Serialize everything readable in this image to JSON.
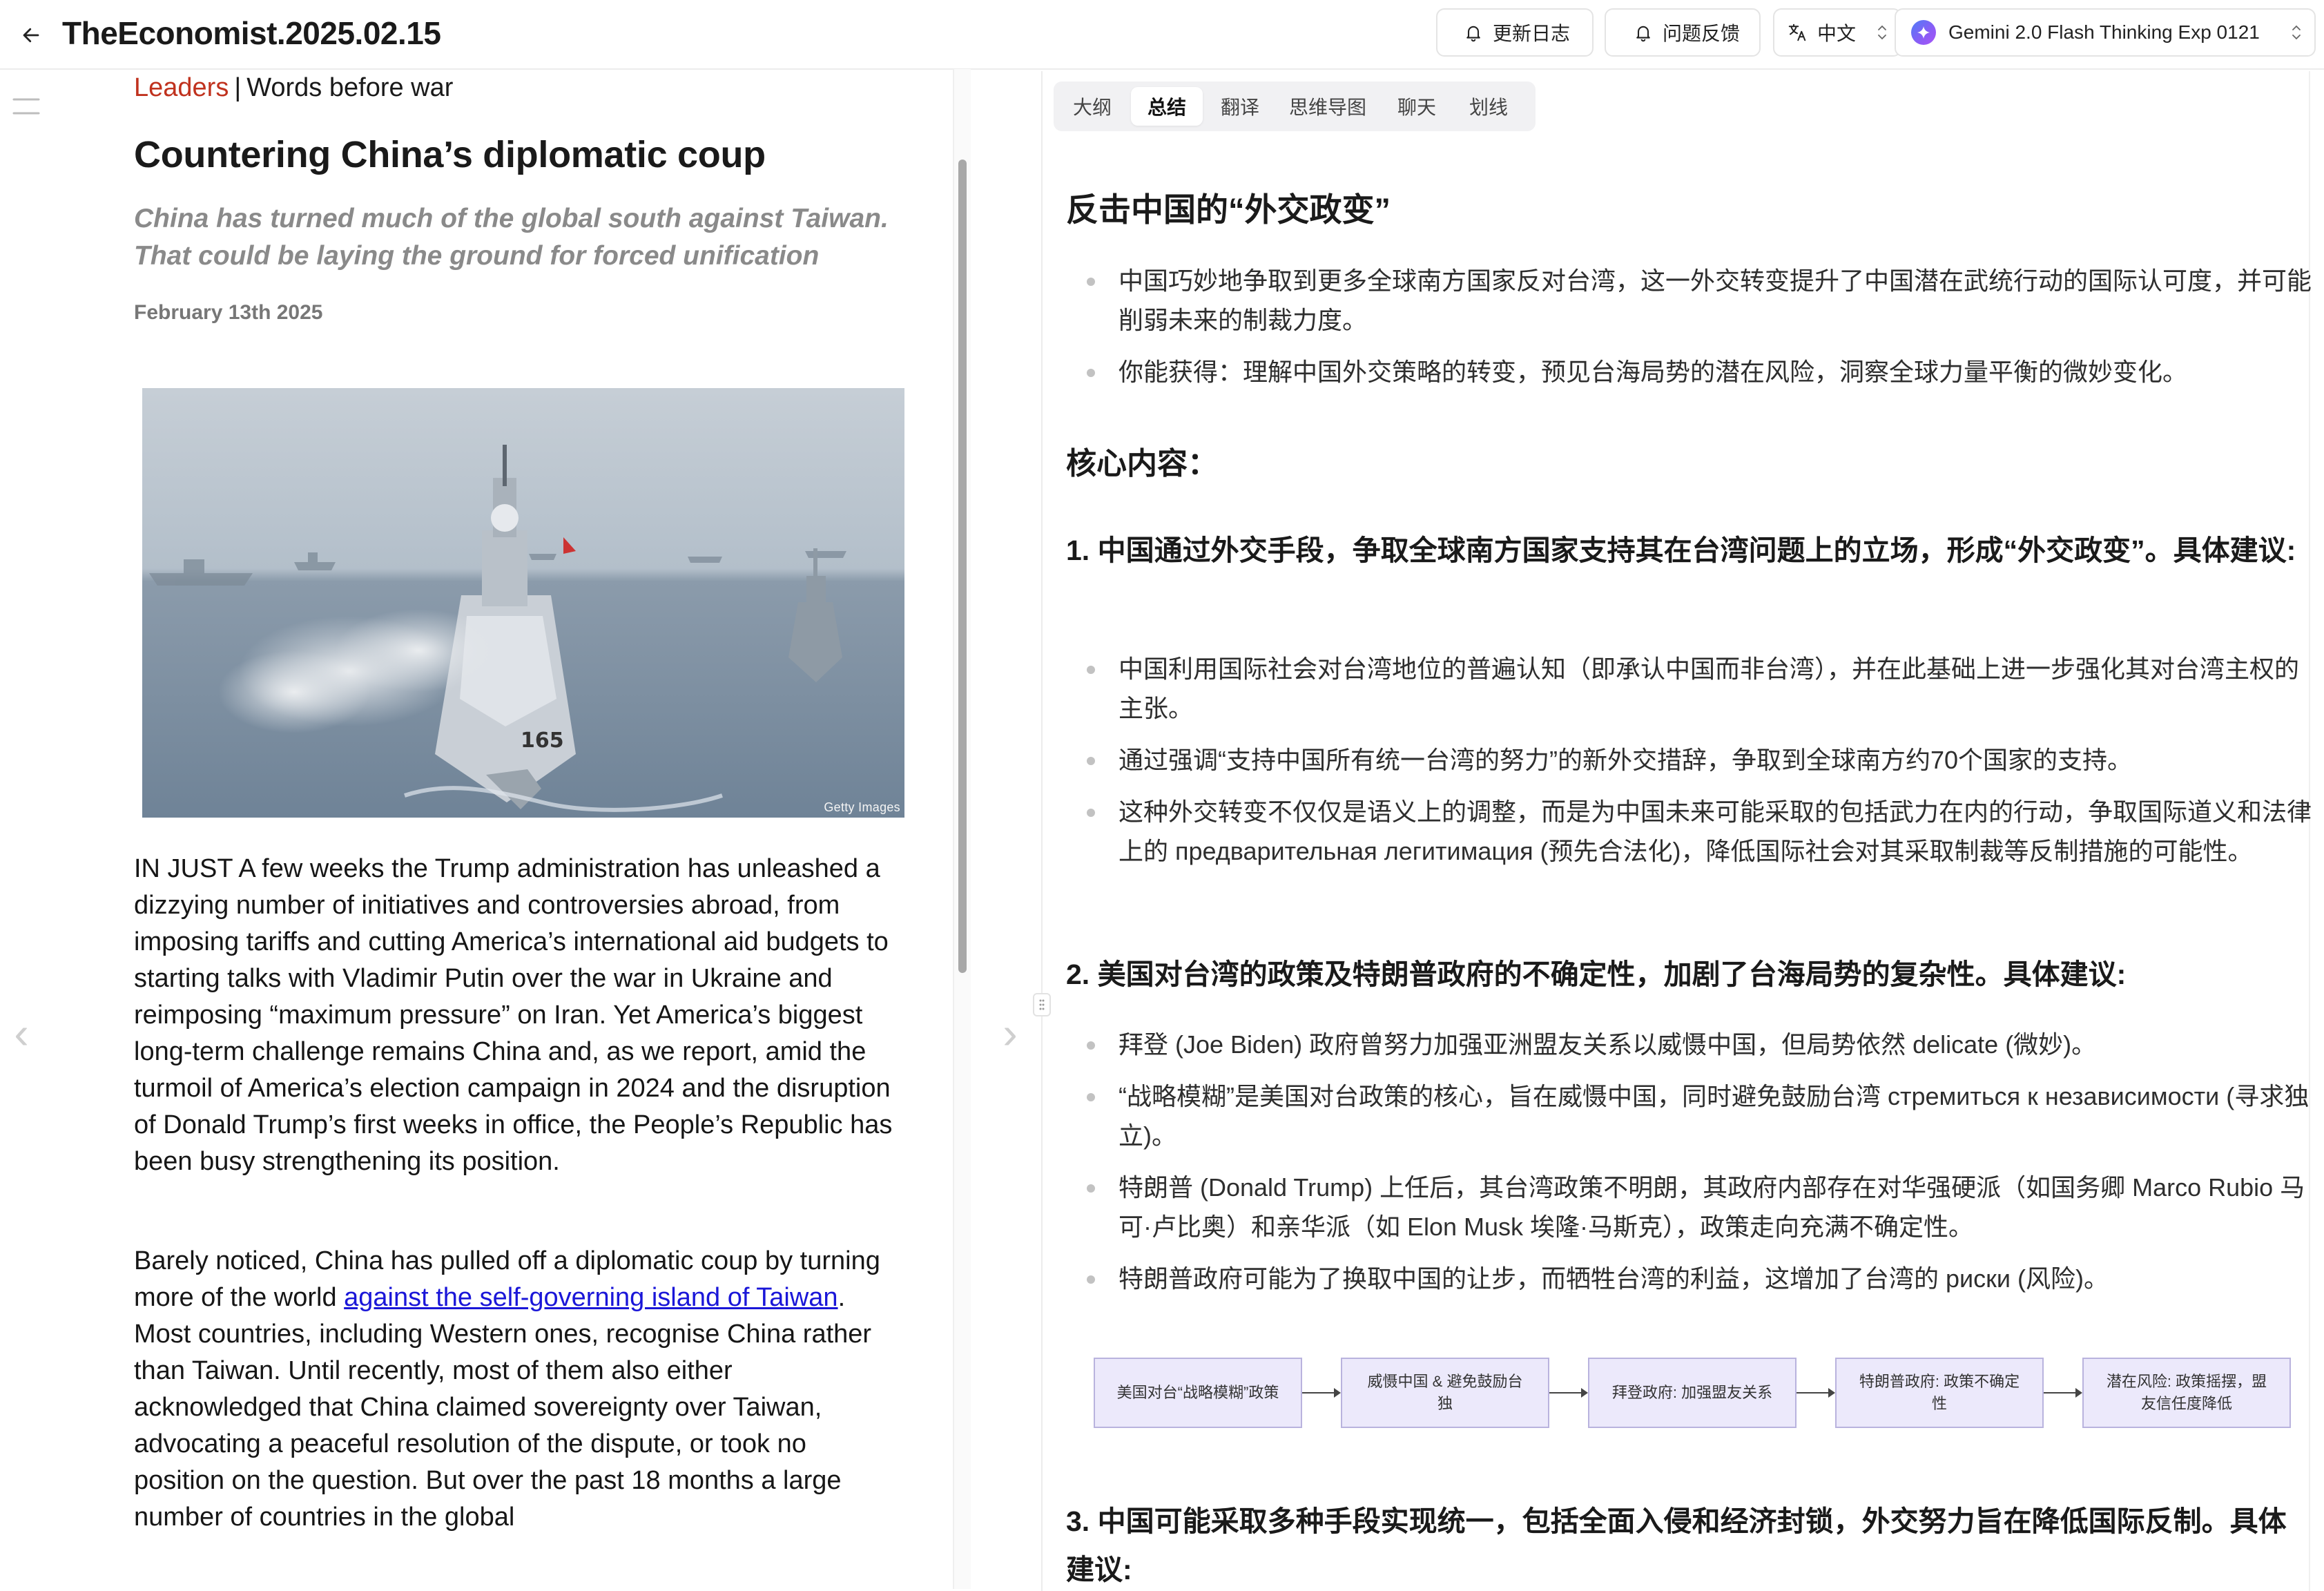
{
  "header": {
    "title": "TheEconomist.2025.02.15",
    "changelog_label": "更新日志",
    "feedback_label": "问题反馈",
    "language_label": "中文",
    "model_label": "Gemini 2.0 Flash Thinking Exp 0121"
  },
  "article": {
    "section": "Leaders",
    "separator": "|",
    "kicker": "Words before war",
    "headline": "Countering China’s diplomatic coup",
    "subheadline": "China has turned much of the global south against Taiwan. That could be laying the ground for forced unification",
    "date": "February 13th 2025",
    "image_credit": "Getty Images",
    "para1": "IN JUST A few weeks the Trump administration has unleashed a dizzying number of initiatives and controversies abroad, from imposing tariffs and cutting America’s international aid budgets to starting talks with Vladimir Putin over the war in Ukraine and reimposing “maximum pressure” on Iran. Yet America’s biggest long-term challenge remains China and, as we report, amid the turmoil of America’s election campaign in 2024 and the disruption of Donald Trump’s first weeks in office, the People’s Republic has been busy strengthening its position.",
    "para2_before": "Barely noticed, China has pulled off a diplomatic coup by turning more of the world ",
    "para2_link": "against the self-governing island of Taiwan",
    "para2_after": ". Most countries, including Western ones, recognise China rather than Taiwan. Until recently, most of them also either acknowledged that China claimed sovereignty over Taiwan, advocating a peaceful resolution of the dispute, or took no position on the question. But over the past 18 months a large number of countries in the global"
  },
  "tabs": [
    {
      "label": "大纲",
      "active": false
    },
    {
      "label": "总结",
      "active": true
    },
    {
      "label": "翻译",
      "active": false
    },
    {
      "label": "思维导图",
      "active": false
    },
    {
      "label": "聊天",
      "active": false
    },
    {
      "label": "划线",
      "active": false
    }
  ],
  "summary": {
    "title": "反击中国的“外交政变”",
    "intro_bullets": [
      "中国巧妙地争取到更多全球南方国家反对台湾，这一外交转变提升了中国潜在武统行动的国际认可度，并可能削弱未来的制裁力度。",
      "你能获得：理解中国外交策略的转变，预见台海局势的潜在风险，洞察全球力量平衡的微妙变化。"
    ],
    "core_heading": "核心内容：",
    "point1_heading": "1. 中国通过外交手段，争取全球南方国家支持其在台湾问题上的立场，形成“外交政变”。具体建议:",
    "point1_bullets": [
      "中国利用国际社会对台湾地位的普遍认知（即承认中国而非台湾），并在此基础上进一步强化其对台湾主权的主张。",
      "通过强调“支持中国所有统一台湾的努力”的新外交措辞，争取到全球南方约70个国家的支持。",
      "这种外交转变不仅仅是语义上的调整，而是为中国未来可能采取的包括武力在内的行动，争取国际道义和法律上的 предварительная легитимация (预先合法化)，降低国际社会对其采取制裁等反制措施的可能性。"
    ],
    "point2_heading": "2. 美国对台湾的政策及特朗普政府的不确定性，加剧了台海局势的复杂性。具体建议:",
    "point2_bullets": [
      "拜登 (Joe Biden) 政府曾努力加强亚洲盟友关系以威慑中国，但局势依然 delicate (微妙)。",
      "“战略模糊”是美国对台政策的核心，旨在威慑中国，同时避免鼓励台湾 стремиться к независимости (寻求独立)。",
      "特朗普 (Donald Trump) 上任后，其台湾政策不明朗，其政府内部存在对华强硬派（如国务卿 Marco Rubio 马可·卢比奥）和亲华派（如 Elon Musk 埃隆·马斯克），政策走向充满不确定性。",
      "特朗普政府可能为了换取中国的让步，而牺牲台湾的利益，这增加了台湾的 риски (风险)。"
    ],
    "flow_nodes": [
      "美国对台“战略模糊”政策",
      "威慑中国 & 避免鼓励台独",
      "拜登政府: 加强盟友关系",
      "特朗普政府: 政策不确定性",
      "潜在风险: 政策摇摆，盟友信任度降低"
    ],
    "point3_heading": "3. 中国可能采取多种手段实现统一，包括全面入侵和经济封锁，外交努力旨在降低国际反制。具体建议:"
  },
  "colors": {
    "section_accent": "#c0321e",
    "link": "#1a16d8",
    "flow_node_fill": "#ece9fb",
    "flow_node_border": "#b9b3de"
  },
  "icons": {
    "back": "arrow-left-icon",
    "bell": "bell-icon",
    "translate": "translate-icon",
    "model": "gemini-sparkle-icon",
    "sidebar_toggle": "sidebar-toggle-icon"
  }
}
